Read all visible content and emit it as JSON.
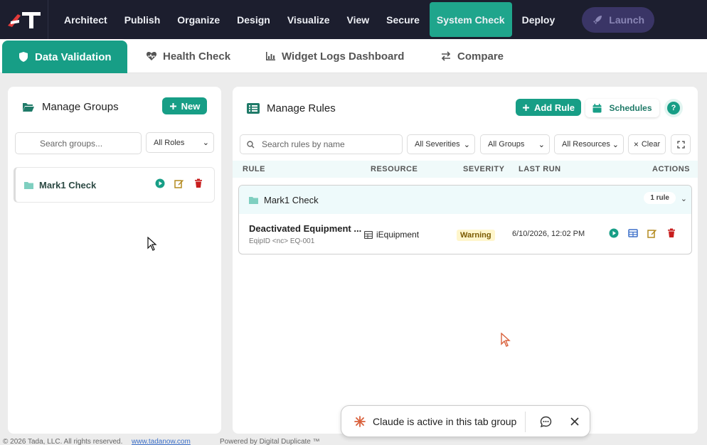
{
  "nav": {
    "items": [
      "Architect",
      "Publish",
      "Organize",
      "Design",
      "Visualize",
      "View",
      "Secure",
      "System Check",
      "Deploy"
    ],
    "active": "System Check",
    "launch_label": "Launch"
  },
  "tabs": [
    {
      "label": "Data Validation",
      "icon": "shield-icon",
      "active": true
    },
    {
      "label": "Health Check",
      "icon": "heartbeat-icon",
      "active": false
    },
    {
      "label": "Widget Logs Dashboard",
      "icon": "bar-chart-icon",
      "active": false
    },
    {
      "label": "Compare",
      "icon": "swap-icon",
      "active": false
    }
  ],
  "groups_panel": {
    "title": "Manage Groups",
    "new_label": "New",
    "search_placeholder": "Search groups...",
    "roles_select": "All Roles",
    "groups": [
      {
        "name": "Mark1 Check"
      }
    ]
  },
  "rules_panel": {
    "title": "Manage Rules",
    "add_rule_label": "Add Rule",
    "schedules_label": "Schedules",
    "help_label": "?",
    "search_placeholder": "Search rules by name",
    "filters": {
      "severities": "All Severities",
      "groups": "All Groups",
      "resources": "All Resources",
      "clear": "Clear"
    },
    "columns": [
      "RULE",
      "RESOURCE",
      "SEVERITY",
      "LAST RUN",
      "ACTIONS"
    ],
    "rule_groups": [
      {
        "name": "Mark1 Check",
        "count_label": "1 rule",
        "rules": [
          {
            "name": "Deactivated Equipment ...",
            "condition": "EqipID <nc> EQ-001",
            "resource": "iEquipment",
            "severity": "Warning",
            "last_run": "6/10/2026, 12:02 PM"
          }
        ]
      }
    ]
  },
  "footer": {
    "copyright": "© 2026 Tada, LLC. All rights reserved.",
    "link": "www.tadanow.com",
    "powered": "Powered by Digital Duplicate ™"
  },
  "toast": {
    "text": "Claude is active in this tab group"
  },
  "colors": {
    "brand_green": "#179e86",
    "nav_bg": "#1c1e2e",
    "danger": "#c81e1e",
    "edit": "#b38a1f",
    "info_blue": "#3b6fc9"
  }
}
